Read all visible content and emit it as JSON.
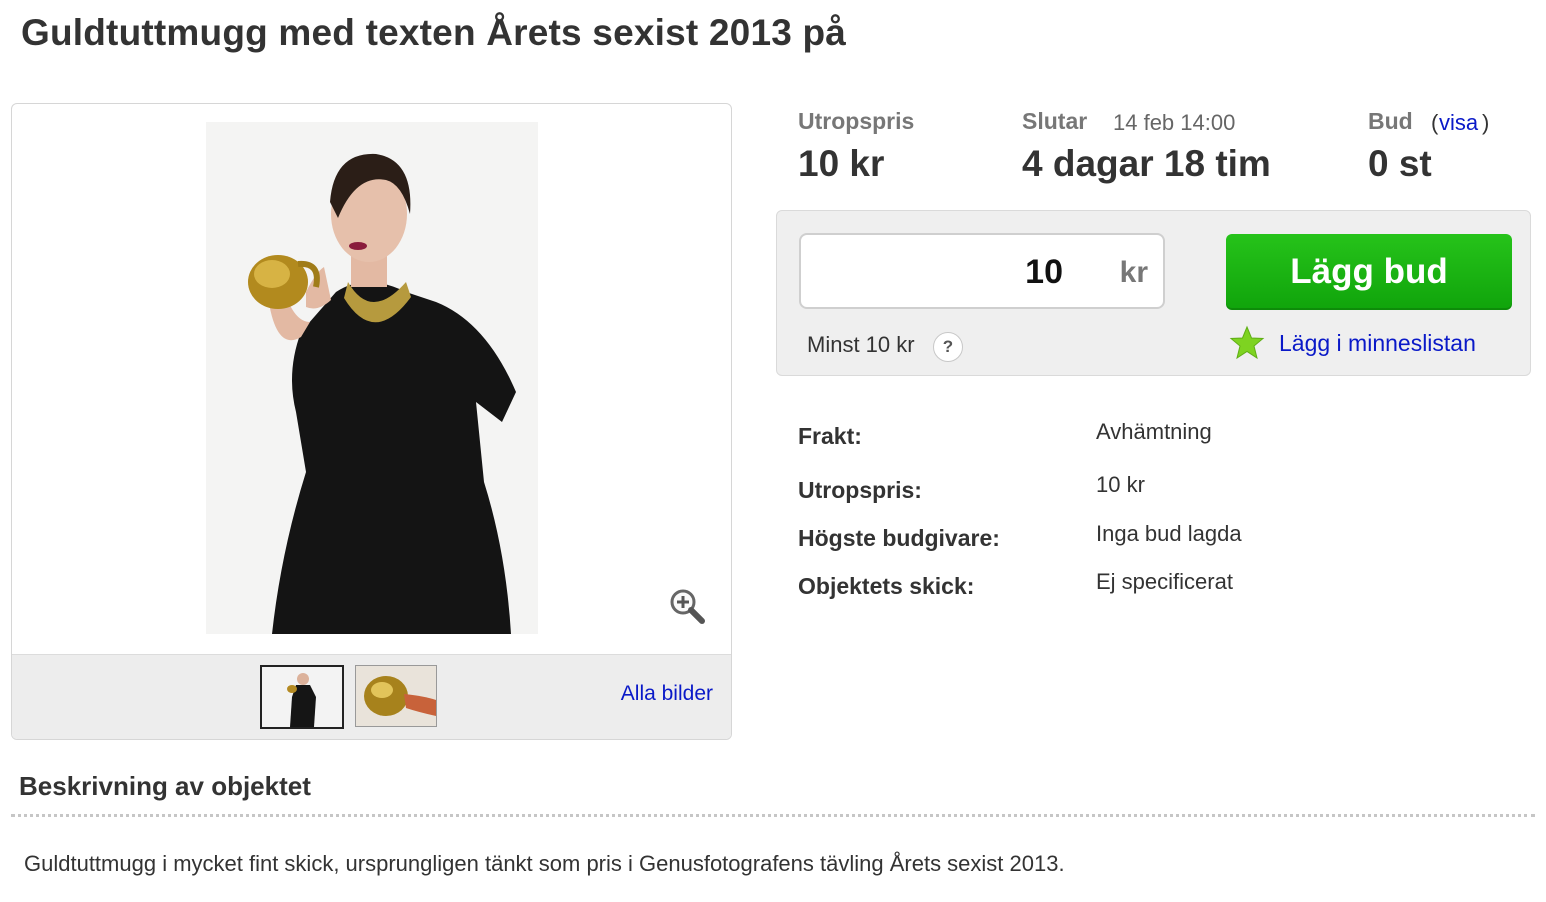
{
  "title": "Guldtuttmugg med texten Årets sexist 2013 på",
  "gallery": {
    "all_images_label": "Alla bilder",
    "thumbnail_count": 2,
    "selected_thumbnail": 1
  },
  "summary": {
    "start_price_label": "Utropspris",
    "start_price_value": "10 kr",
    "ends_label": "Slutar",
    "ends_date": "14 feb 14:00",
    "time_left": "4 dagar 18 tim",
    "bids_label": "Bud",
    "bids_open_paren": "(",
    "bids_show_link": "visa",
    "bids_close_paren": ")",
    "bids_value": "0 st"
  },
  "bid": {
    "input_value": "10",
    "unit": "kr",
    "button_label": "Lägg bud",
    "min_text": "Minst 10 kr",
    "help_label": "?",
    "watch_label": "Lägg i minneslistan"
  },
  "details": [
    {
      "label": "Frakt:",
      "value": "Avhämtning"
    },
    {
      "label": "Utropspris:",
      "value": "10 kr"
    },
    {
      "label": "Högste budgivare:",
      "value": "Inga bud lagda"
    },
    {
      "label": "Objektets skick:",
      "value": "Ej specificerat"
    }
  ],
  "description": {
    "heading": "Beskrivning av objektet",
    "text": "Guldtuttmugg i mycket fint skick, ursprungligen tänkt som pris i Genusfotografens tävling Årets sexist 2013."
  },
  "colors": {
    "link": "#0a19c8",
    "bid_button": "#14aa0f",
    "star": "#7ed321"
  },
  "icons": {
    "zoom": "zoom-in-icon",
    "star": "star-icon",
    "help": "help-icon"
  }
}
